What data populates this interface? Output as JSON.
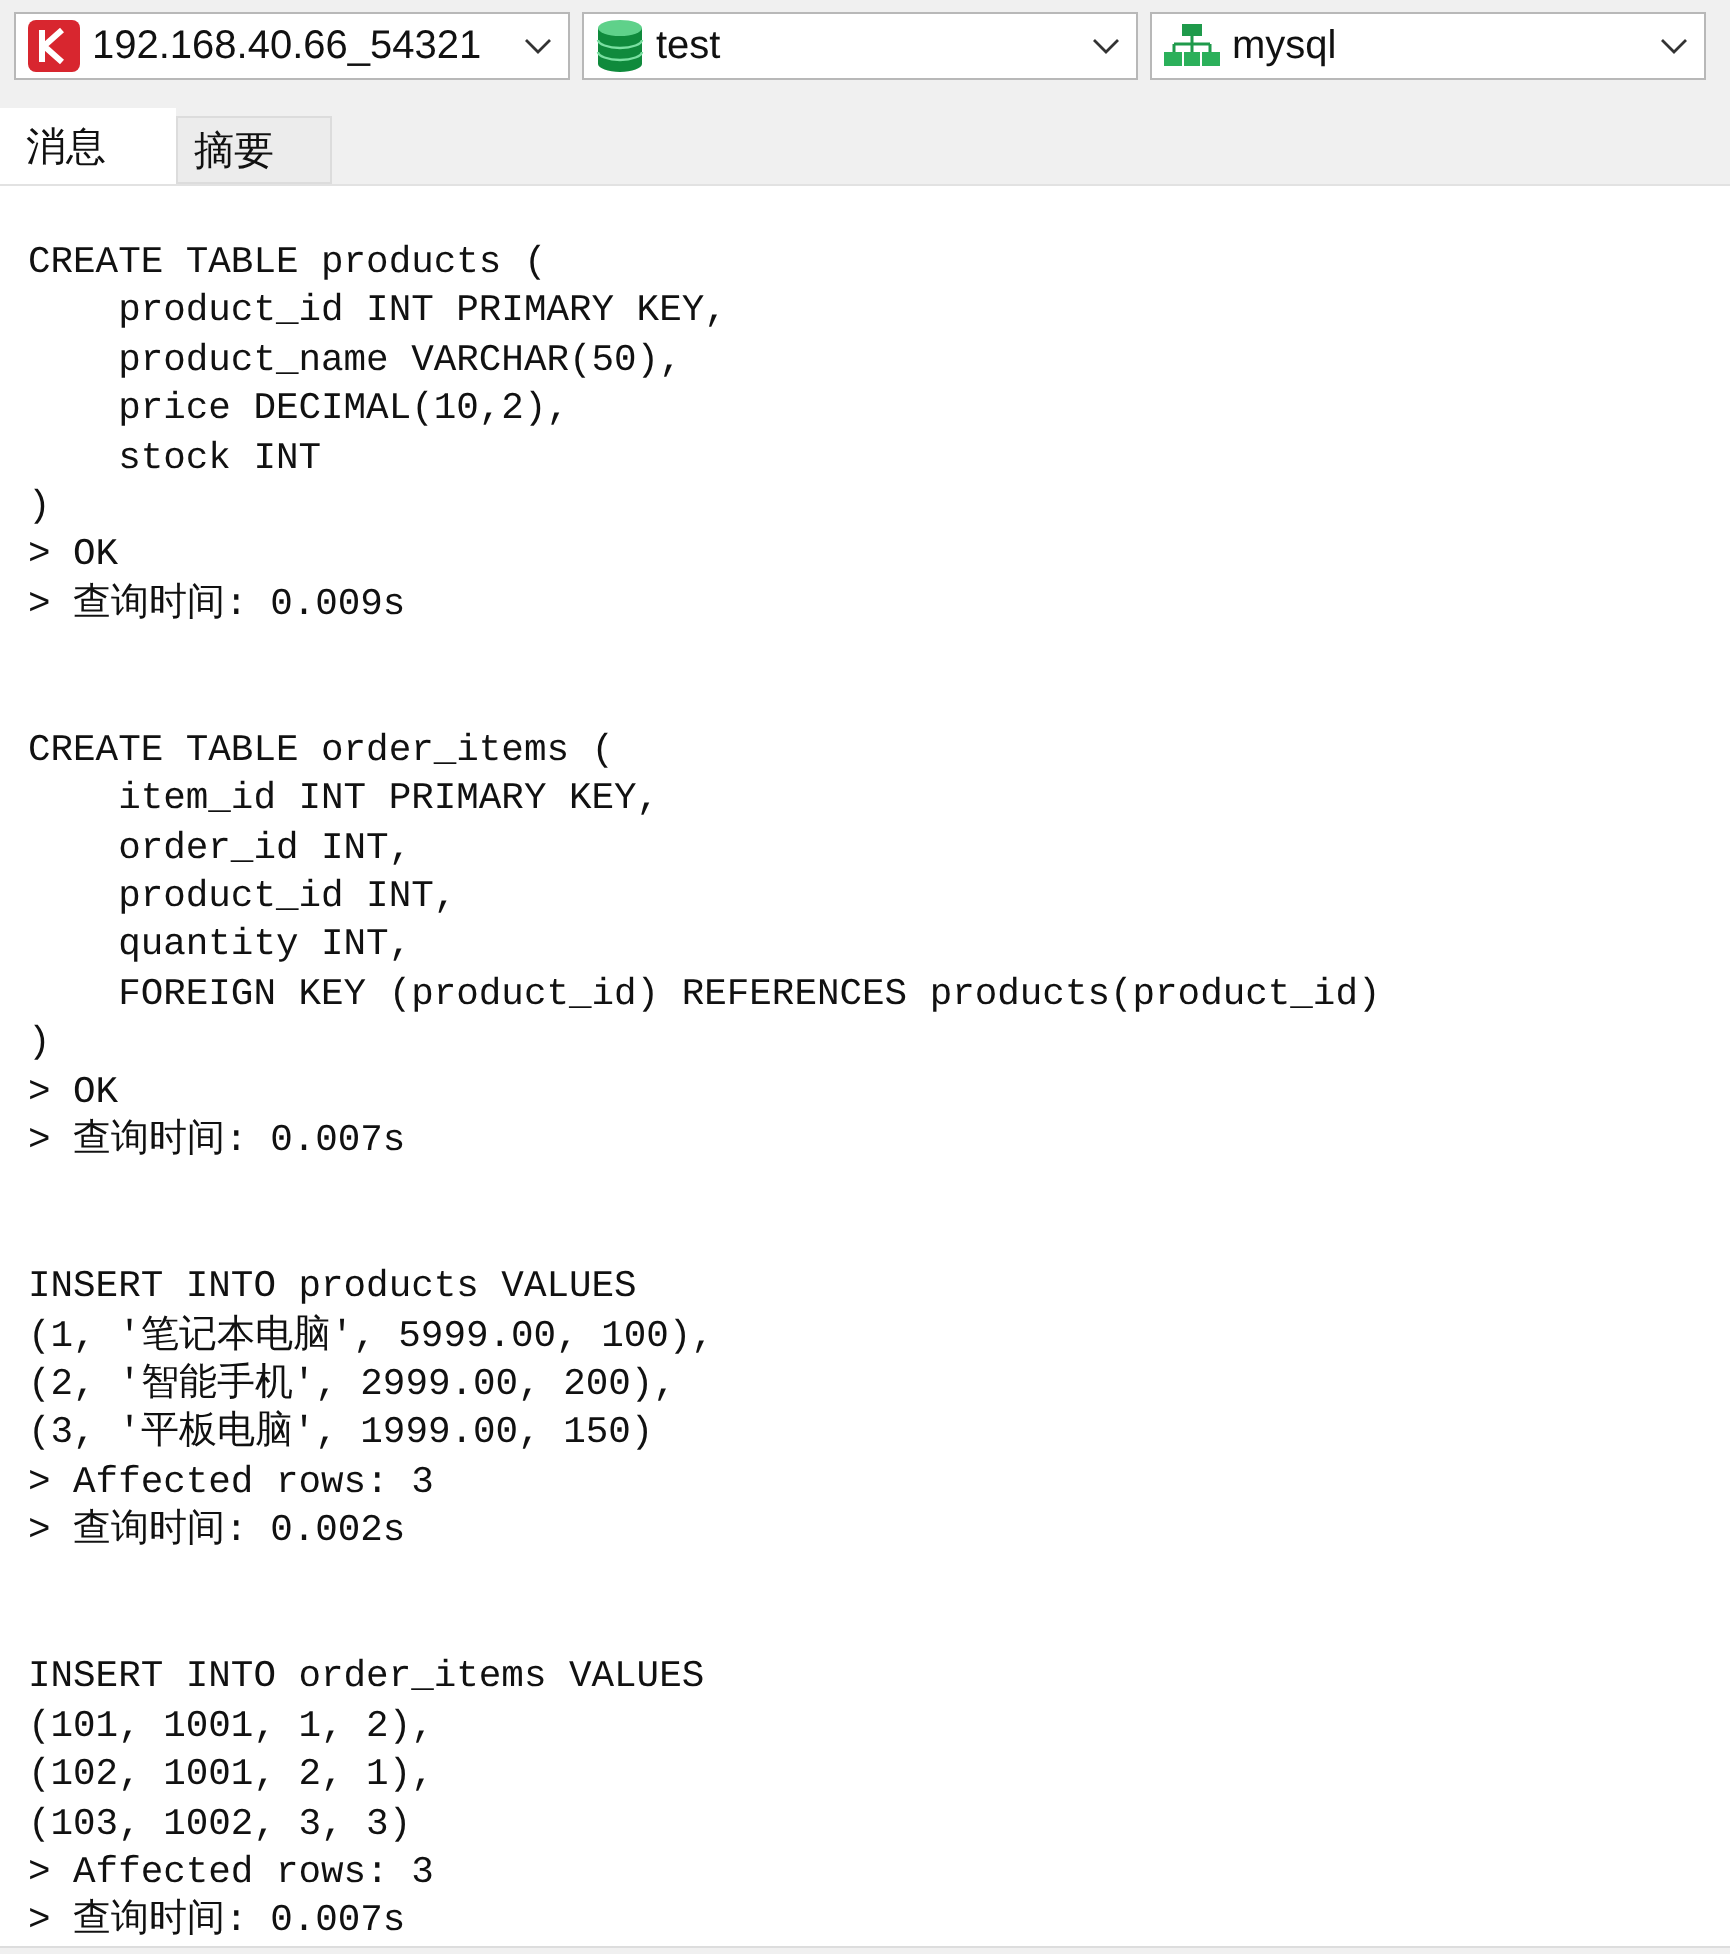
{
  "selectors": [
    {
      "kind": "connection",
      "text": "192.168.40.66_54321"
    },
    {
      "kind": "database",
      "text": "test"
    },
    {
      "kind": "schema",
      "text": "mysql"
    }
  ],
  "tabs": [
    {
      "label": "消息",
      "selected": true
    },
    {
      "label": "摘要",
      "selected": false
    }
  ],
  "messages": [
    {
      "statement": [
        "CREATE TABLE products (",
        "    product_id INT PRIMARY KEY,",
        "    product_name VARCHAR(50),",
        "    price DECIMAL(10,2),",
        "    stock INT",
        ")"
      ],
      "results": [
        "> OK",
        "> 查询时间: 0.009s"
      ]
    },
    {
      "statement": [
        "CREATE TABLE order_items (",
        "    item_id INT PRIMARY KEY,",
        "    order_id INT,",
        "    product_id INT,",
        "    quantity INT,",
        "    FOREIGN KEY (product_id) REFERENCES products(product_id)",
        ")"
      ],
      "results": [
        "> OK",
        "> 查询时间: 0.007s"
      ]
    },
    {
      "statement": [
        "INSERT INTO products VALUES",
        "(1, '笔记本电脑', 5999.00, 100),",
        "(2, '智能手机', 2999.00, 200),",
        "(3, '平板电脑', 1999.00, 150)"
      ],
      "results": [
        "> Affected rows: 3",
        "> 查询时间: 0.002s"
      ]
    },
    {
      "statement": [
        "INSERT INTO order_items VALUES",
        "(101, 1001, 1, 2),",
        "(102, 1001, 2, 1),",
        "(103, 1002, 3, 3)"
      ],
      "results": [
        "> Affected rows: 3",
        "> 查询时间: 0.007s"
      ]
    }
  ]
}
